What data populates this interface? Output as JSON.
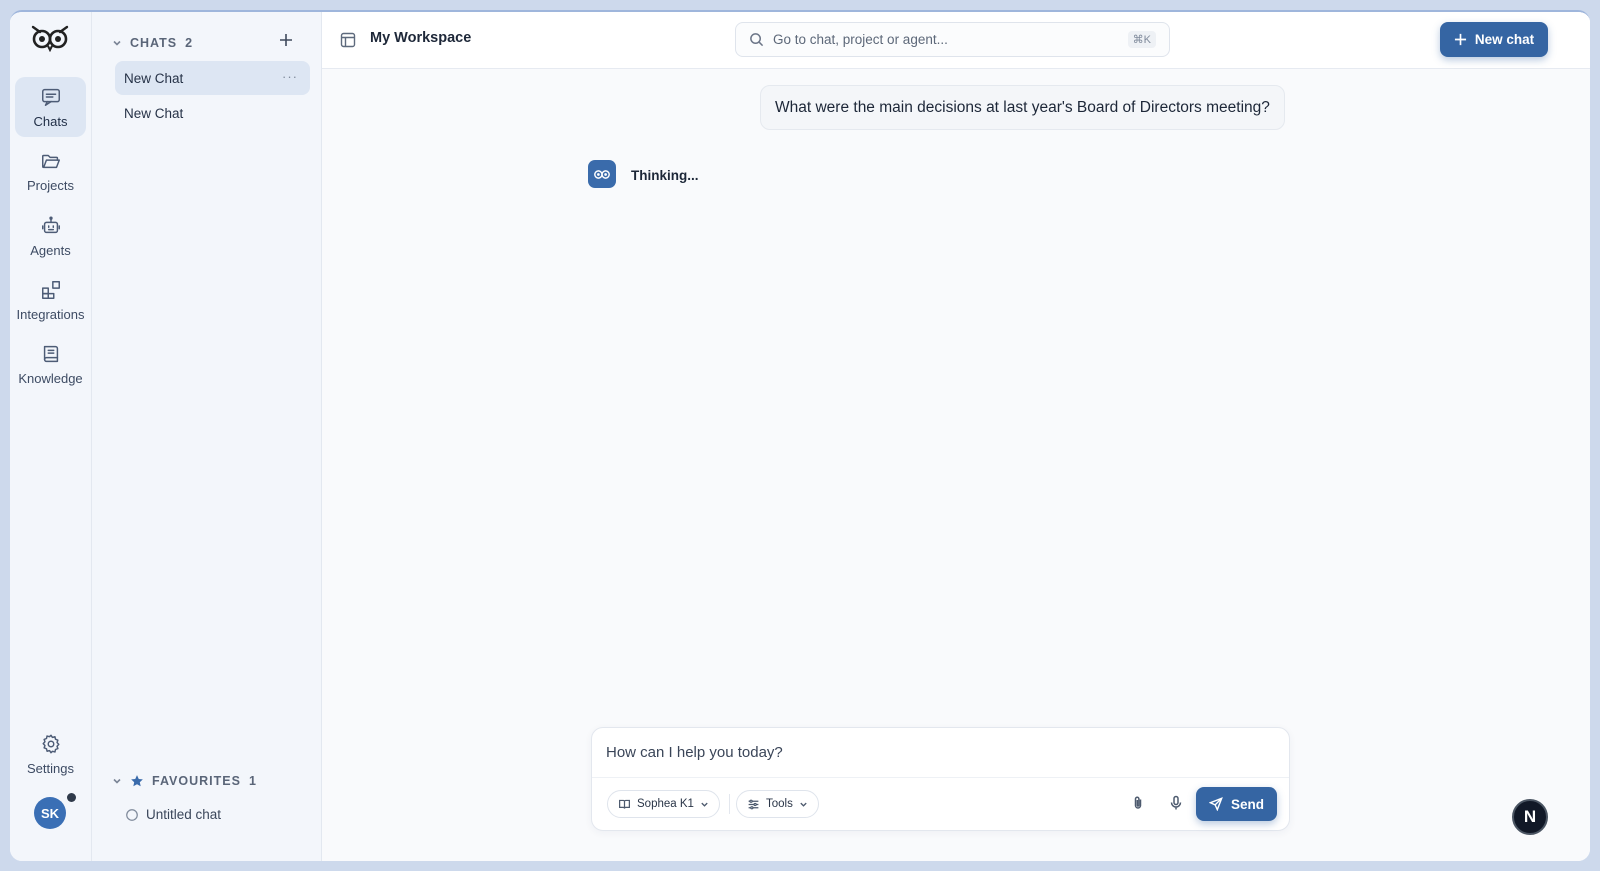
{
  "rail": {
    "items": [
      {
        "label": "Chats",
        "icon": "chat-icon"
      },
      {
        "label": "Projects",
        "icon": "folder-icon"
      },
      {
        "label": "Agents",
        "icon": "robot-icon"
      },
      {
        "label": "Integrations",
        "icon": "blocks-icon"
      },
      {
        "label": "Knowledge",
        "icon": "book-icon"
      }
    ],
    "settings_label": "Settings",
    "avatar_initials": "SK"
  },
  "panel": {
    "chats_header": "CHATS",
    "chats_count": "2",
    "chats": [
      {
        "title": "New Chat"
      },
      {
        "title": "New Chat"
      }
    ],
    "favourites_header": "FAVOURITES",
    "favourites_count": "1",
    "favourites": [
      {
        "title": "Untitled chat"
      }
    ]
  },
  "topbar": {
    "workspace_title": "My Workspace",
    "search_placeholder": "Go to chat, project or agent...",
    "search_shortcut": "⌘K",
    "new_chat_label": "New chat"
  },
  "conversation": {
    "user_message": "What were the main decisions at last year's Board of Directors meeting?",
    "assistant_status": "Thinking..."
  },
  "composer": {
    "placeholder": "How can I help you today?",
    "model_label": "Sophea K1",
    "tools_label": "Tools",
    "send_label": "Send"
  },
  "badge": {
    "letter": "N"
  },
  "colors": {
    "accent": "#3565a3",
    "rail_bg": "#f3f6fb",
    "active_item": "#dde6f3"
  }
}
